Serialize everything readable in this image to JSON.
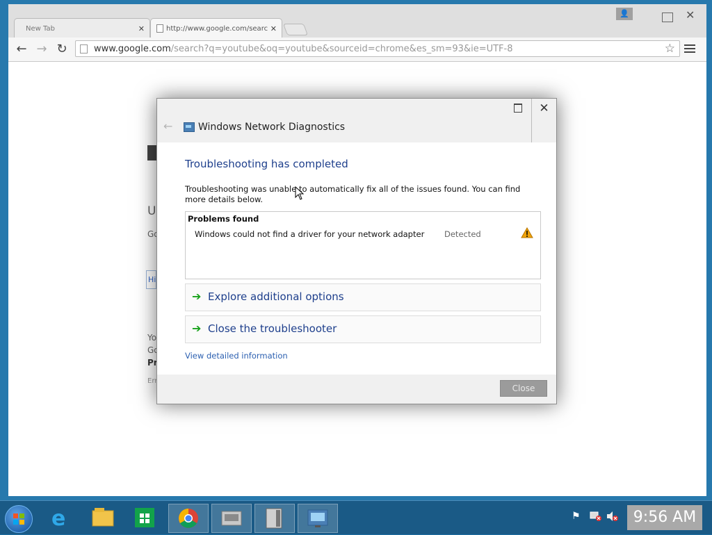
{
  "browser": {
    "tabs": [
      {
        "label": "New Tab",
        "active": false
      },
      {
        "label": "http://www.google.com/searc",
        "active": true
      }
    ],
    "address_domain": "www.google.com",
    "address_path": "/search?q=youtube&oq=youtube&sourceid=chrome&es_sm=93&ie=UTF-8"
  },
  "background_fragments": [
    "U",
    "Go",
    "Hi",
    "Yo",
    "Go",
    "Pr",
    "Err"
  ],
  "dialog": {
    "title": "Windows Network Diagnostics",
    "heading": "Troubleshooting has completed",
    "description": "Troubleshooting was unable to automatically fix all of the issues found. You can find more details below.",
    "problems_title": "Problems found",
    "problem": {
      "text": "Windows could not find a driver for your network adapter",
      "status": "Detected"
    },
    "options": [
      {
        "label": "Explore additional options"
      },
      {
        "label": "Close the troubleshooter"
      }
    ],
    "details_link": "View detailed information",
    "close_button": "Close"
  },
  "taskbar": {
    "clock": "9:56 AM",
    "apps": [
      "internet-explorer",
      "file-explorer",
      "store",
      "chrome",
      "network-app",
      "server-app",
      "network-diagnostics"
    ]
  },
  "colors": {
    "accent_heading": "#1e3f8c",
    "link": "#2b5fb0",
    "arrow": "#19a21c",
    "warning": "#f0a30a"
  }
}
